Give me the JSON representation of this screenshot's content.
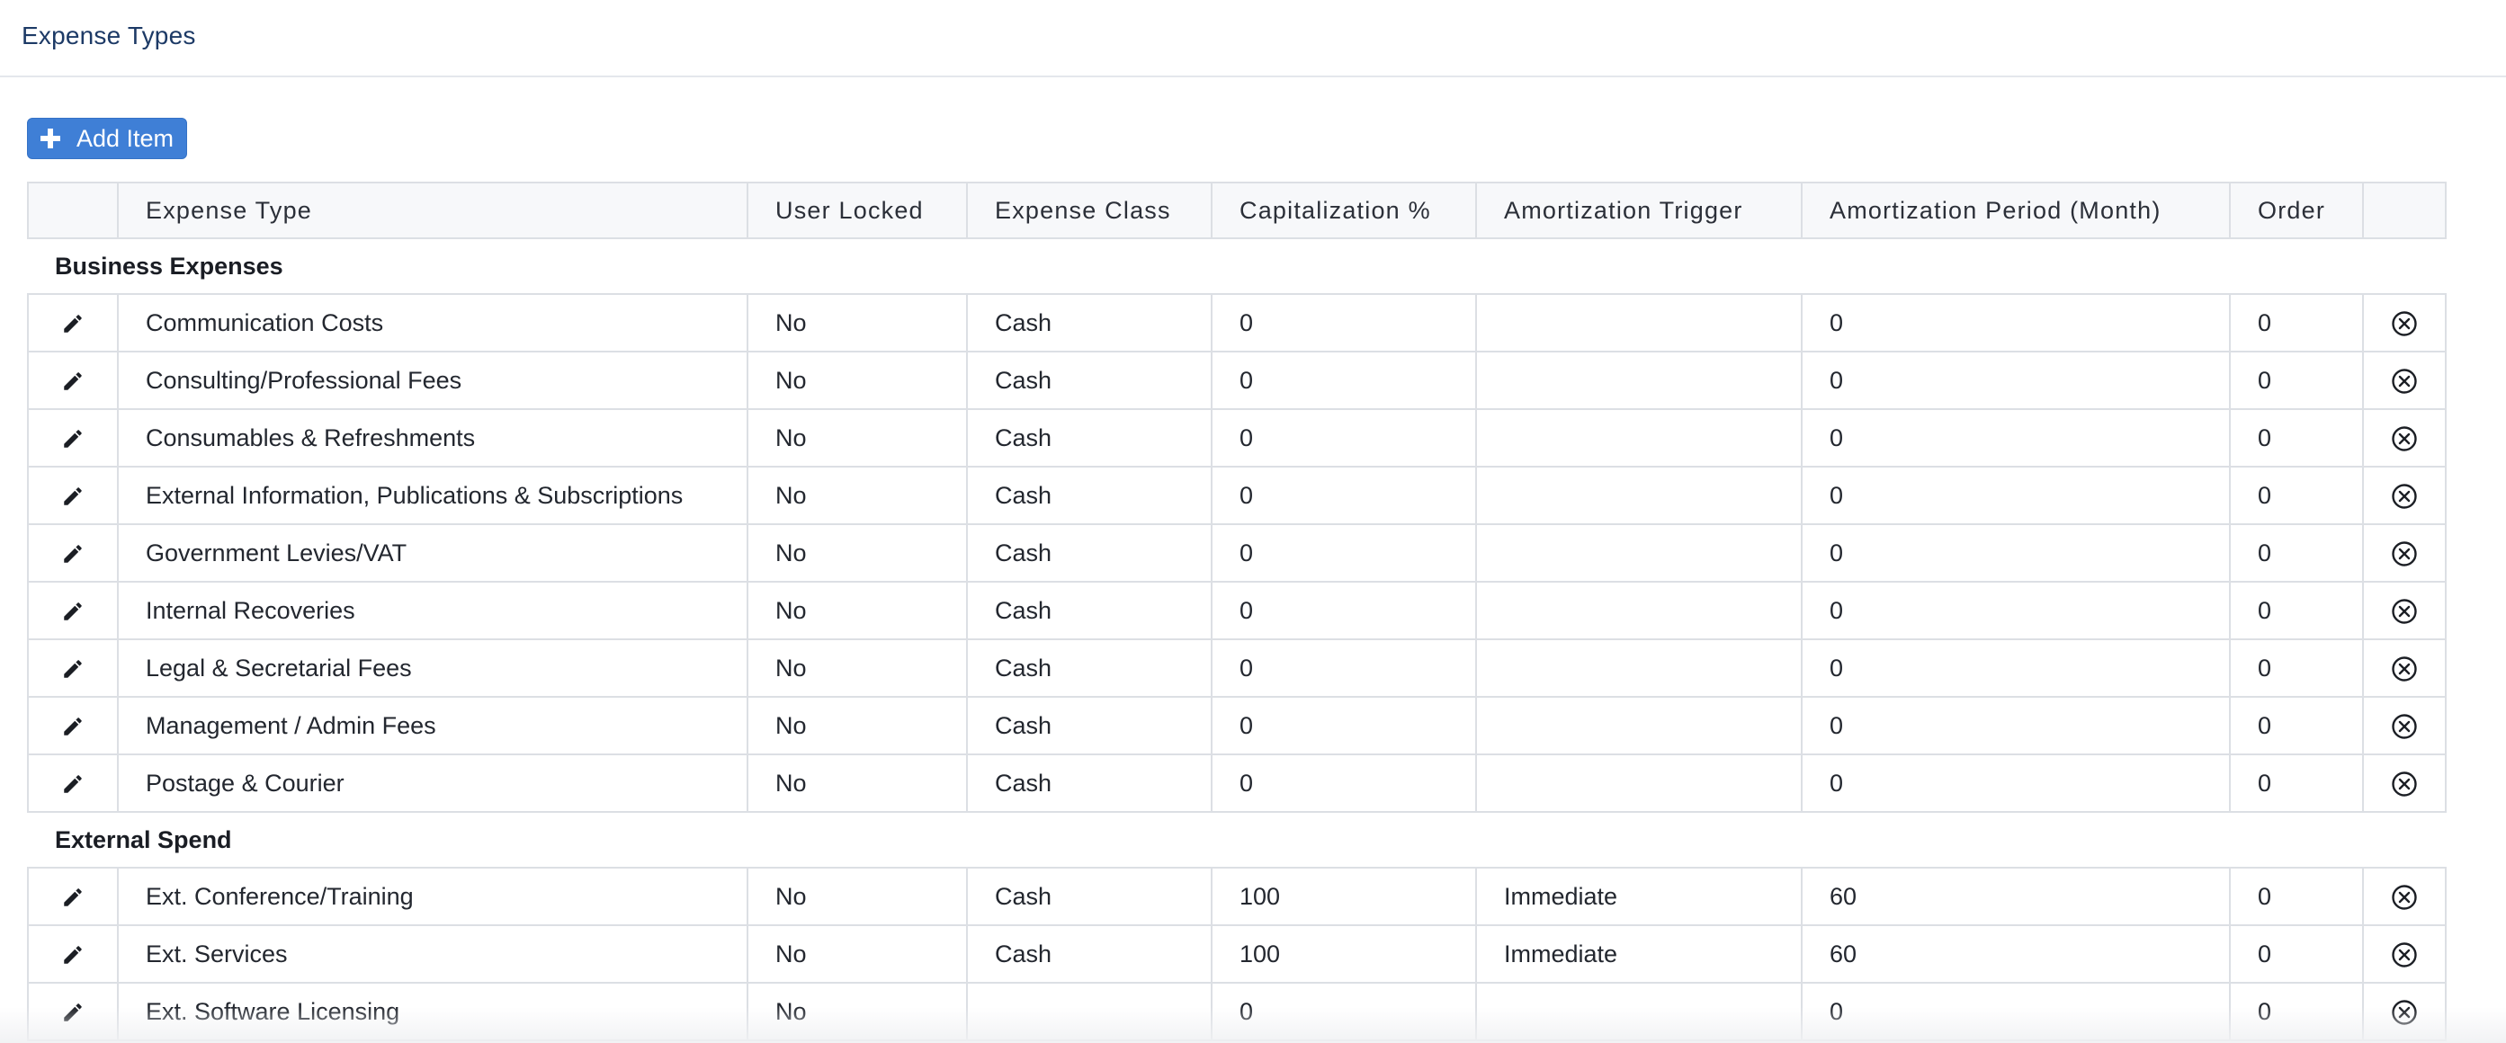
{
  "page": {
    "title": "Expense Types",
    "add_button_label": "Add Item"
  },
  "table": {
    "columns": [
      "Expense Type",
      "User Locked",
      "Expense Class",
      "Capitalization %",
      "Amortization Trigger",
      "Amortization Period (Month)",
      "Order"
    ],
    "groups": [
      {
        "name": "Business Expenses",
        "rows": [
          {
            "type": "Communication Costs",
            "locked": "No",
            "class": "Cash",
            "cap": "0",
            "trigger": "",
            "period": "0",
            "order": "0"
          },
          {
            "type": "Consulting/Professional Fees",
            "locked": "No",
            "class": "Cash",
            "cap": "0",
            "trigger": "",
            "period": "0",
            "order": "0"
          },
          {
            "type": "Consumables & Refreshments",
            "locked": "No",
            "class": "Cash",
            "cap": "0",
            "trigger": "",
            "period": "0",
            "order": "0"
          },
          {
            "type": "External Information, Publications & Subscriptions",
            "locked": "No",
            "class": "Cash",
            "cap": "0",
            "trigger": "",
            "period": "0",
            "order": "0"
          },
          {
            "type": "Government Levies/VAT",
            "locked": "No",
            "class": "Cash",
            "cap": "0",
            "trigger": "",
            "period": "0",
            "order": "0"
          },
          {
            "type": "Internal Recoveries",
            "locked": "No",
            "class": "Cash",
            "cap": "0",
            "trigger": "",
            "period": "0",
            "order": "0"
          },
          {
            "type": "Legal & Secretarial Fees",
            "locked": "No",
            "class": "Cash",
            "cap": "0",
            "trigger": "",
            "period": "0",
            "order": "0"
          },
          {
            "type": "Management / Admin Fees",
            "locked": "No",
            "class": "Cash",
            "cap": "0",
            "trigger": "",
            "period": "0",
            "order": "0"
          },
          {
            "type": "Postage & Courier",
            "locked": "No",
            "class": "Cash",
            "cap": "0",
            "trigger": "",
            "period": "0",
            "order": "0"
          }
        ]
      },
      {
        "name": "External Spend",
        "rows": [
          {
            "type": "Ext. Conference/Training",
            "locked": "No",
            "class": "Cash",
            "cap": "100",
            "trigger": "Immediate",
            "period": "60",
            "order": "0"
          },
          {
            "type": "Ext. Services",
            "locked": "No",
            "class": "Cash",
            "cap": "100",
            "trigger": "Immediate",
            "period": "60",
            "order": "0"
          },
          {
            "type": "Ext. Software Licensing",
            "locked": "No",
            "class": "",
            "cap": "0",
            "trigger": "",
            "period": "0",
            "order": "0"
          }
        ]
      }
    ]
  },
  "icons": {
    "add": "plus-icon",
    "edit": "pencil-icon",
    "remove": "circle-x-icon"
  },
  "colors": {
    "accent": "#3f7fd6",
    "title": "#1d3a66",
    "border": "#dcdfe4",
    "header_bg": "#f7f8fa"
  }
}
